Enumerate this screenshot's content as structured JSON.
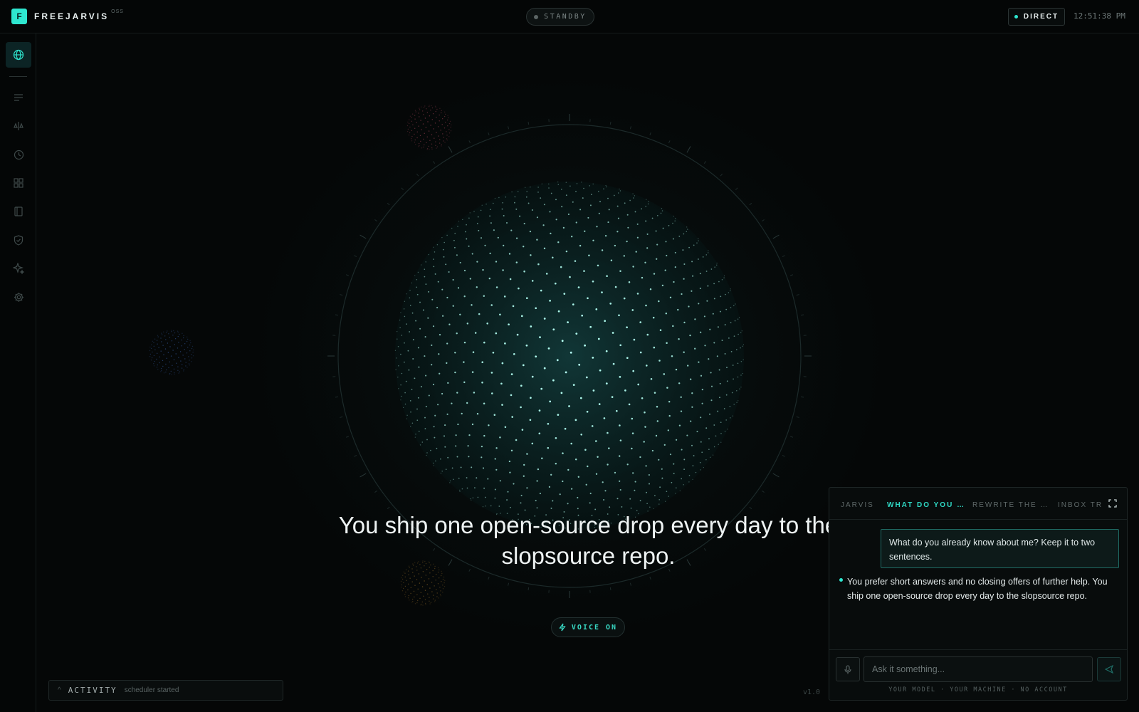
{
  "app": {
    "logo_letter": "F",
    "name": "FREEJARVIS",
    "tag": "OSS",
    "status": "STANDBY",
    "mode": "DIRECT",
    "clock": "12:51:38 PM",
    "version": "v1.0",
    "accent": "#2ee6cf"
  },
  "sidebar": {
    "items": [
      {
        "icon": "globe-icon",
        "active": true
      },
      {
        "icon": "list-icon",
        "active": false
      },
      {
        "icon": "scale-icon",
        "active": false
      },
      {
        "icon": "clock-icon",
        "active": false
      },
      {
        "icon": "grid-icon",
        "active": false
      },
      {
        "icon": "book-icon",
        "active": false
      },
      {
        "icon": "shield-icon",
        "active": false
      },
      {
        "icon": "sparkle-icon",
        "active": false
      },
      {
        "icon": "gear-icon",
        "active": false
      }
    ]
  },
  "main": {
    "headline": "You ship one open-source drop every day to the slopsource repo.",
    "voice_label": "VOICE ON"
  },
  "activity": {
    "label": "ACTIVITY",
    "text": "scheduler started"
  },
  "chat": {
    "tabs": [
      {
        "label": "JARVIS",
        "active": false
      },
      {
        "label": "WHAT DO YOU …",
        "active": true
      },
      {
        "label": "REWRITE THE …",
        "active": false
      },
      {
        "label": "INBOX TRI",
        "active": false
      }
    ],
    "user_message": "What do you already know about me? Keep it to two sentences.",
    "assistant_message": "You prefer short answers and no closing offers of further help. You ship one open-source drop every day to the slopsource repo.",
    "input_placeholder": "Ask it something...",
    "footer": "YOUR MODEL · YOUR MACHINE · NO ACCOUNT"
  }
}
